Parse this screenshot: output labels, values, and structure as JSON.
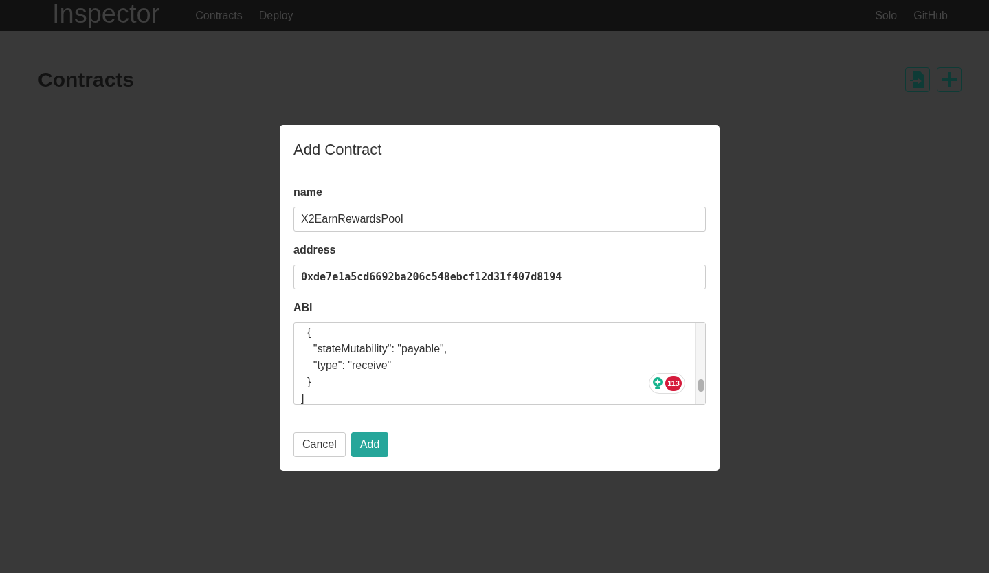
{
  "navbar": {
    "brand": "Inspector",
    "links": [
      {
        "label": "Contracts"
      },
      {
        "label": "Deploy"
      }
    ],
    "right_links": [
      {
        "label": "Solo"
      },
      {
        "label": "GitHub"
      }
    ]
  },
  "page": {
    "title": "Contracts"
  },
  "dialog": {
    "title": "Add Contract",
    "fields": [
      {
        "label": "name",
        "value": "X2EarnRewardsPool",
        "kind": "text"
      },
      {
        "label": "address",
        "value": "0xde7e1a5cd6692ba206c548ebcf12d31f407d8194",
        "kind": "mono"
      }
    ],
    "abi": {
      "label": "ABI",
      "lines": [
        "  {",
        "    \"stateMutability\": \"payable\",",
        "    \"type\": \"receive\"",
        "  }",
        "]"
      ],
      "badge_count": "113"
    },
    "buttons": [
      {
        "label": "Cancel",
        "kind": "secondary"
      },
      {
        "label": "Add",
        "kind": "primary"
      }
    ]
  }
}
